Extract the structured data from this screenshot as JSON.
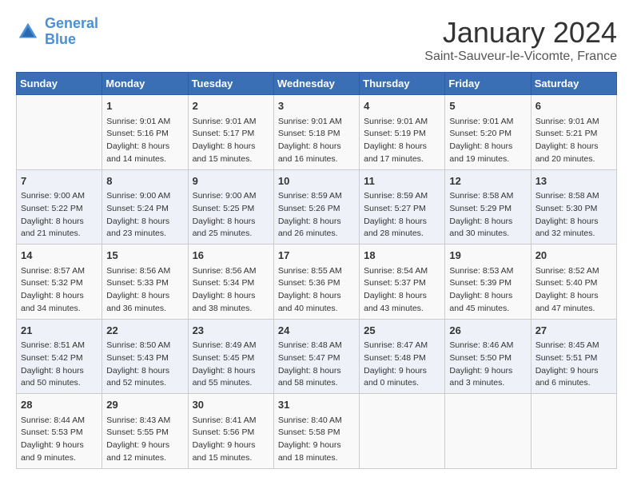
{
  "header": {
    "logo_line1": "General",
    "logo_line2": "Blue",
    "month": "January 2024",
    "location": "Saint-Sauveur-le-Vicomte, France"
  },
  "days_of_week": [
    "Sunday",
    "Monday",
    "Tuesday",
    "Wednesday",
    "Thursday",
    "Friday",
    "Saturday"
  ],
  "weeks": [
    [
      {
        "day": "",
        "content": ""
      },
      {
        "day": "1",
        "content": "Sunrise: 9:01 AM\nSunset: 5:16 PM\nDaylight: 8 hours\nand 14 minutes."
      },
      {
        "day": "2",
        "content": "Sunrise: 9:01 AM\nSunset: 5:17 PM\nDaylight: 8 hours\nand 15 minutes."
      },
      {
        "day": "3",
        "content": "Sunrise: 9:01 AM\nSunset: 5:18 PM\nDaylight: 8 hours\nand 16 minutes."
      },
      {
        "day": "4",
        "content": "Sunrise: 9:01 AM\nSunset: 5:19 PM\nDaylight: 8 hours\nand 17 minutes."
      },
      {
        "day": "5",
        "content": "Sunrise: 9:01 AM\nSunset: 5:20 PM\nDaylight: 8 hours\nand 19 minutes."
      },
      {
        "day": "6",
        "content": "Sunrise: 9:01 AM\nSunset: 5:21 PM\nDaylight: 8 hours\nand 20 minutes."
      }
    ],
    [
      {
        "day": "7",
        "content": "Sunrise: 9:00 AM\nSunset: 5:22 PM\nDaylight: 8 hours\nand 21 minutes."
      },
      {
        "day": "8",
        "content": "Sunrise: 9:00 AM\nSunset: 5:24 PM\nDaylight: 8 hours\nand 23 minutes."
      },
      {
        "day": "9",
        "content": "Sunrise: 9:00 AM\nSunset: 5:25 PM\nDaylight: 8 hours\nand 25 minutes."
      },
      {
        "day": "10",
        "content": "Sunrise: 8:59 AM\nSunset: 5:26 PM\nDaylight: 8 hours\nand 26 minutes."
      },
      {
        "day": "11",
        "content": "Sunrise: 8:59 AM\nSunset: 5:27 PM\nDaylight: 8 hours\nand 28 minutes."
      },
      {
        "day": "12",
        "content": "Sunrise: 8:58 AM\nSunset: 5:29 PM\nDaylight: 8 hours\nand 30 minutes."
      },
      {
        "day": "13",
        "content": "Sunrise: 8:58 AM\nSunset: 5:30 PM\nDaylight: 8 hours\nand 32 minutes."
      }
    ],
    [
      {
        "day": "14",
        "content": "Sunrise: 8:57 AM\nSunset: 5:32 PM\nDaylight: 8 hours\nand 34 minutes."
      },
      {
        "day": "15",
        "content": "Sunrise: 8:56 AM\nSunset: 5:33 PM\nDaylight: 8 hours\nand 36 minutes."
      },
      {
        "day": "16",
        "content": "Sunrise: 8:56 AM\nSunset: 5:34 PM\nDaylight: 8 hours\nand 38 minutes."
      },
      {
        "day": "17",
        "content": "Sunrise: 8:55 AM\nSunset: 5:36 PM\nDaylight: 8 hours\nand 40 minutes."
      },
      {
        "day": "18",
        "content": "Sunrise: 8:54 AM\nSunset: 5:37 PM\nDaylight: 8 hours\nand 43 minutes."
      },
      {
        "day": "19",
        "content": "Sunrise: 8:53 AM\nSunset: 5:39 PM\nDaylight: 8 hours\nand 45 minutes."
      },
      {
        "day": "20",
        "content": "Sunrise: 8:52 AM\nSunset: 5:40 PM\nDaylight: 8 hours\nand 47 minutes."
      }
    ],
    [
      {
        "day": "21",
        "content": "Sunrise: 8:51 AM\nSunset: 5:42 PM\nDaylight: 8 hours\nand 50 minutes."
      },
      {
        "day": "22",
        "content": "Sunrise: 8:50 AM\nSunset: 5:43 PM\nDaylight: 8 hours\nand 52 minutes."
      },
      {
        "day": "23",
        "content": "Sunrise: 8:49 AM\nSunset: 5:45 PM\nDaylight: 8 hours\nand 55 minutes."
      },
      {
        "day": "24",
        "content": "Sunrise: 8:48 AM\nSunset: 5:47 PM\nDaylight: 8 hours\nand 58 minutes."
      },
      {
        "day": "25",
        "content": "Sunrise: 8:47 AM\nSunset: 5:48 PM\nDaylight: 9 hours\nand 0 minutes."
      },
      {
        "day": "26",
        "content": "Sunrise: 8:46 AM\nSunset: 5:50 PM\nDaylight: 9 hours\nand 3 minutes."
      },
      {
        "day": "27",
        "content": "Sunrise: 8:45 AM\nSunset: 5:51 PM\nDaylight: 9 hours\nand 6 minutes."
      }
    ],
    [
      {
        "day": "28",
        "content": "Sunrise: 8:44 AM\nSunset: 5:53 PM\nDaylight: 9 hours\nand 9 minutes."
      },
      {
        "day": "29",
        "content": "Sunrise: 8:43 AM\nSunset: 5:55 PM\nDaylight: 9 hours\nand 12 minutes."
      },
      {
        "day": "30",
        "content": "Sunrise: 8:41 AM\nSunset: 5:56 PM\nDaylight: 9 hours\nand 15 minutes."
      },
      {
        "day": "31",
        "content": "Sunrise: 8:40 AM\nSunset: 5:58 PM\nDaylight: 9 hours\nand 18 minutes."
      },
      {
        "day": "",
        "content": ""
      },
      {
        "day": "",
        "content": ""
      },
      {
        "day": "",
        "content": ""
      }
    ]
  ]
}
